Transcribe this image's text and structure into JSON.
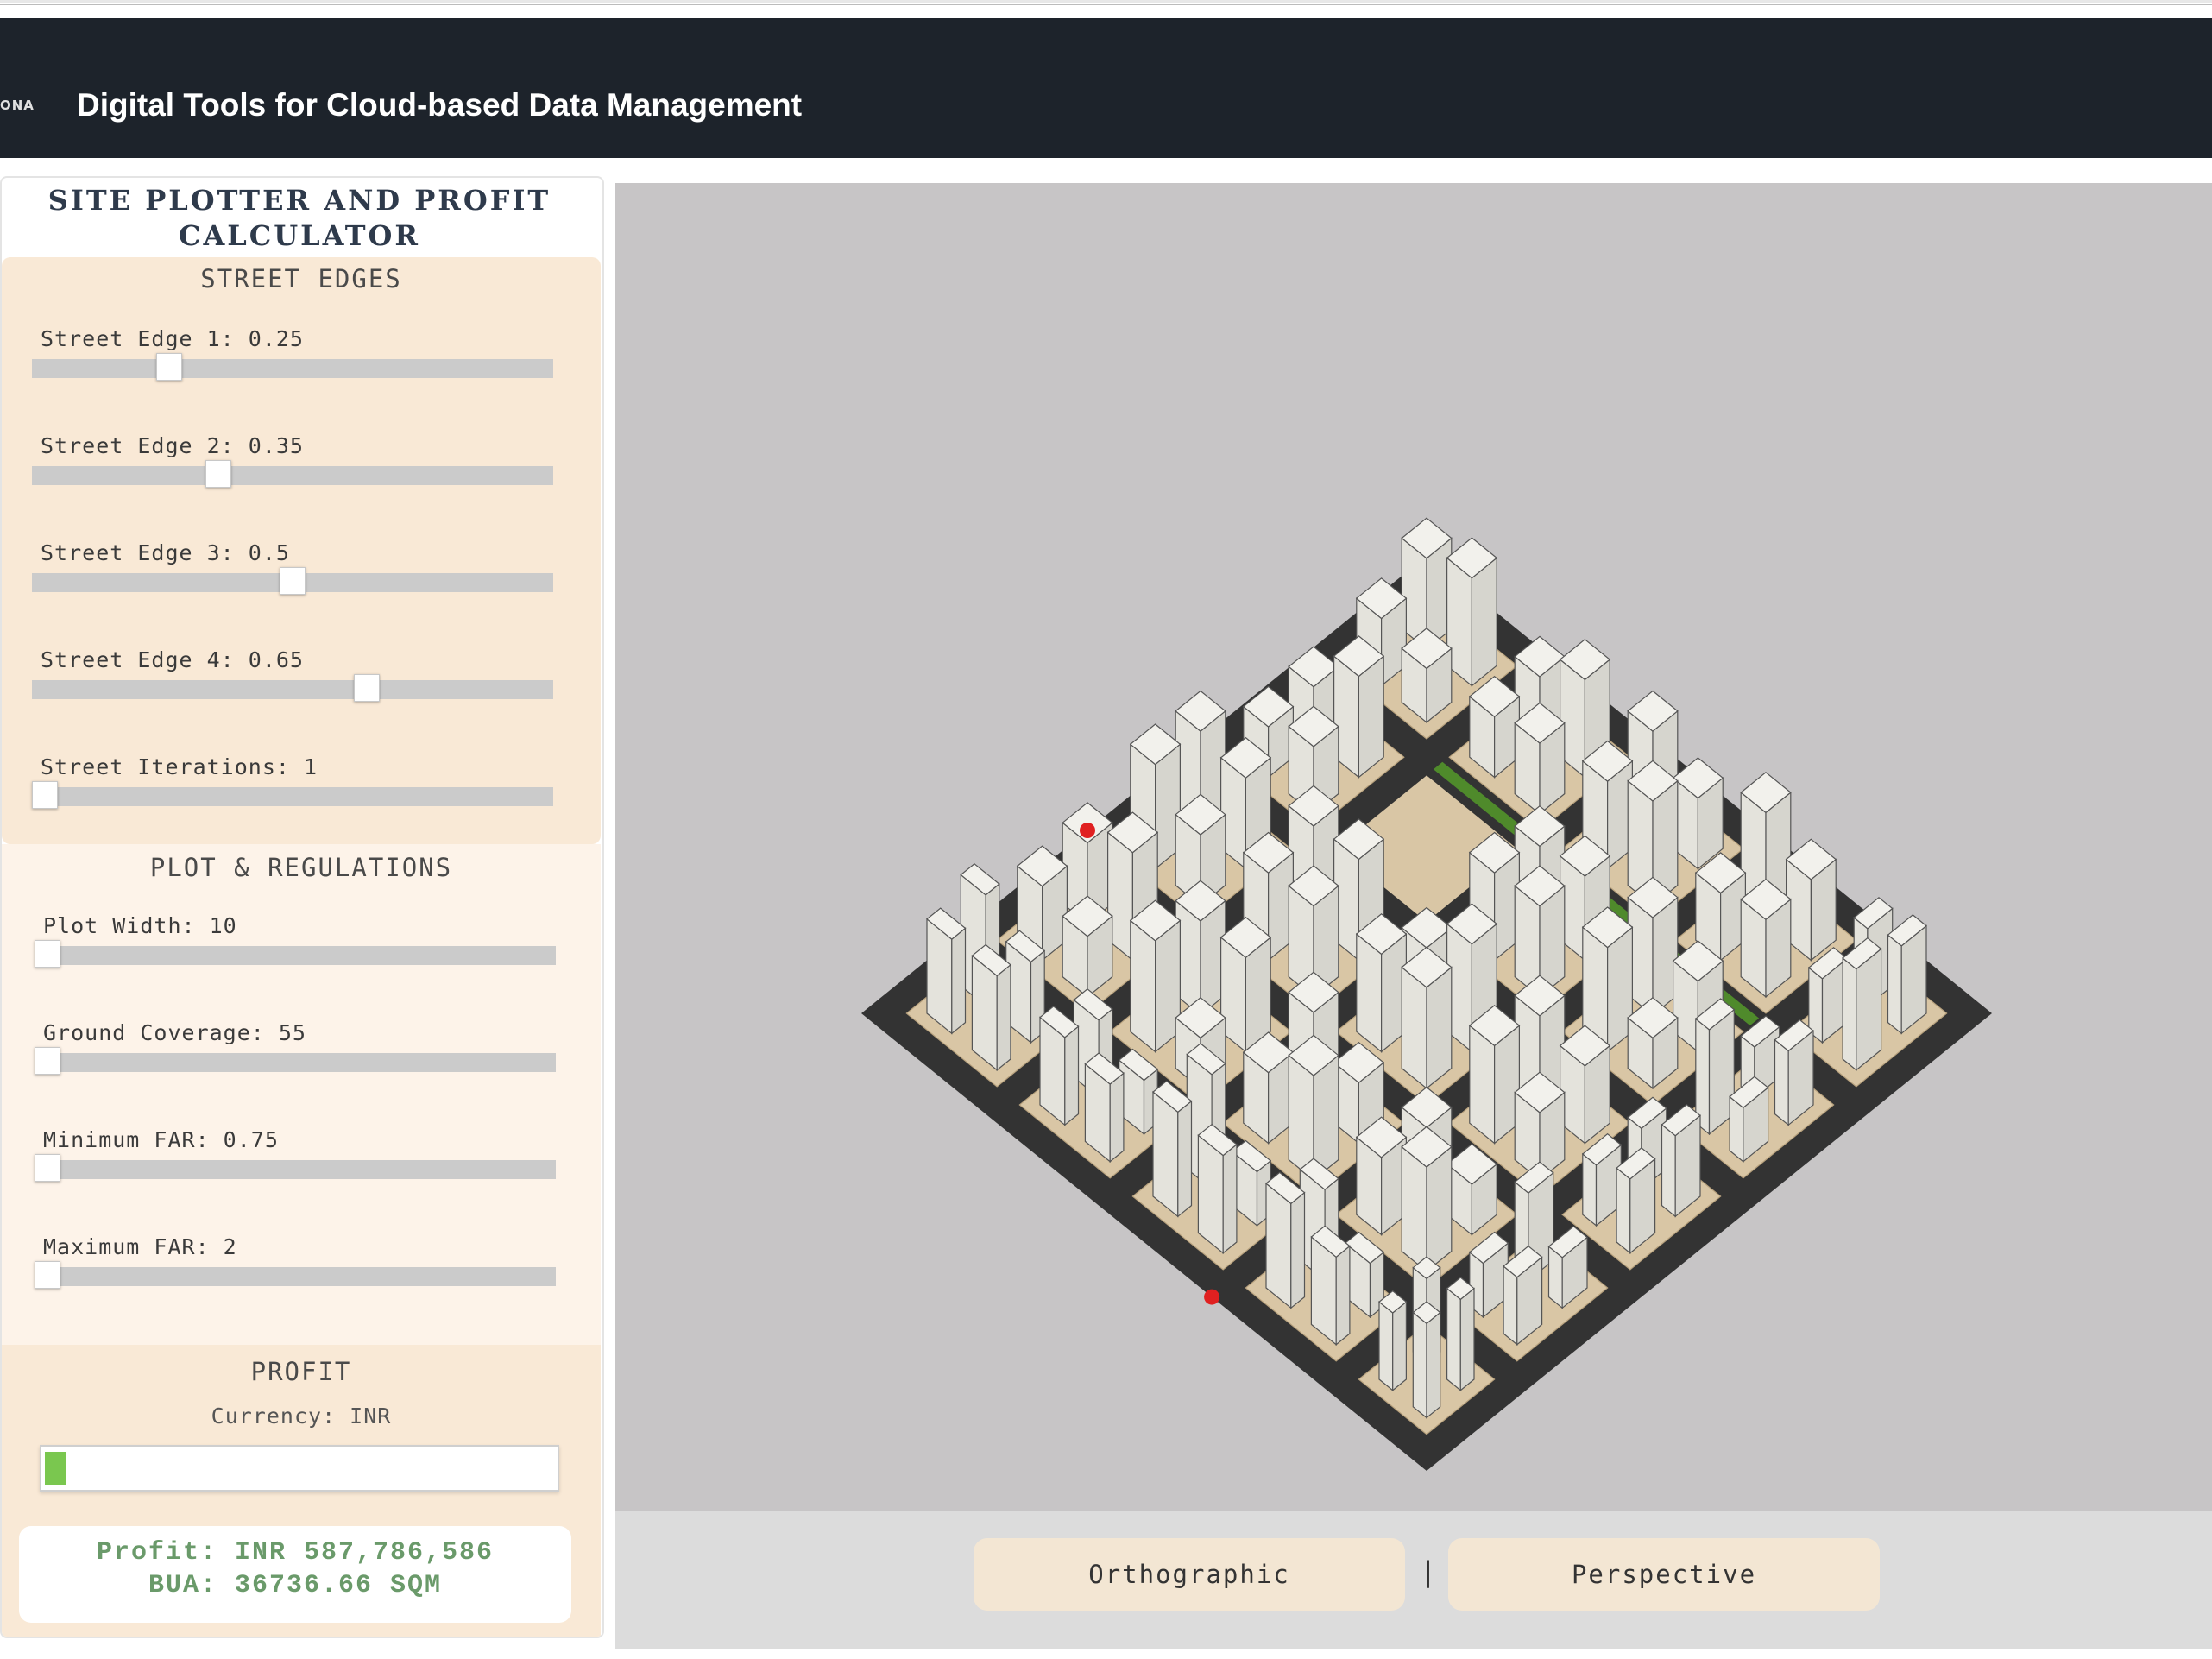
{
  "header": {
    "logo_text": "ONA",
    "title": "Digital Tools for Cloud-based Data Management"
  },
  "panel": {
    "title": "SITE PLOTTER AND PROFIT CALCULATOR",
    "street_section": {
      "heading": "STREET EDGES",
      "sliders": [
        {
          "label": "Street Edge 1: 0.25",
          "value": 0.25,
          "min": 0,
          "max": 1
        },
        {
          "label": "Street Edge 2: 0.35",
          "value": 0.35,
          "min": 0,
          "max": 1
        },
        {
          "label": "Street Edge 3: 0.5",
          "value": 0.5,
          "min": 0,
          "max": 1
        },
        {
          "label": "Street Edge 4: 0.65",
          "value": 0.65,
          "min": 0,
          "max": 1
        },
        {
          "label": "Street Iterations: 1",
          "value": 1,
          "min": 1,
          "max": 5
        }
      ]
    },
    "plot_section": {
      "heading": "PLOT & REGULATIONS",
      "sliders": [
        {
          "label": "Plot Width: 10",
          "value": 10,
          "min": 10,
          "max": 50
        },
        {
          "label": "Ground Coverage: 55",
          "value": 55,
          "min": 55,
          "max": 100
        },
        {
          "label": "Minimum FAR: 0.75",
          "value": 0.75,
          "min": 0.75,
          "max": 5
        },
        {
          "label": "Maximum FAR: 2",
          "value": 2,
          "min": 2,
          "max": 10
        }
      ]
    },
    "profit_section": {
      "heading": "PROFIT",
      "currency": "Currency: INR",
      "profit_fill_fraction": 0.04,
      "profit_line": "Profit: INR 587,786,586",
      "bua_line": "BUA: 36736.66 SQM"
    }
  },
  "viewport": {
    "colors": {
      "background": "#c7c5c6",
      "road": "#333333",
      "plot": "#d9c6a5",
      "park": "#4f8a2b",
      "building": "#f2f1ec",
      "marker": "#e02020"
    }
  },
  "view_buttons": {
    "orthographic": "Orthographic",
    "separator": "|",
    "perspective": "Perspective"
  }
}
